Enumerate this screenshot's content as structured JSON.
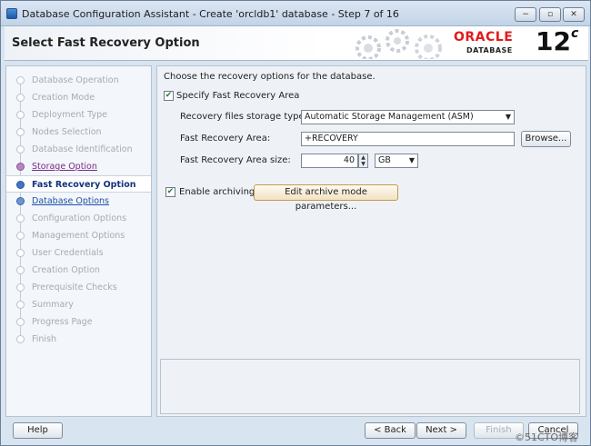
{
  "window": {
    "title": "Database Configuration Assistant - Create 'orcldb1' database - Step 7 of 16",
    "min": "−",
    "max": "▫",
    "close": "✕"
  },
  "banner": {
    "title": "Select Fast Recovery Option",
    "oracle": "ORACLE",
    "database": "DATABASE",
    "version": "12",
    "version_suffix": "c"
  },
  "nav": {
    "items": [
      {
        "label": "Database Operation",
        "state": "disabled"
      },
      {
        "label": "Creation Mode",
        "state": "disabled"
      },
      {
        "label": "Deployment Type",
        "state": "disabled"
      },
      {
        "label": "Nodes Selection",
        "state": "disabled"
      },
      {
        "label": "Database Identification",
        "state": "disabled"
      },
      {
        "label": "Storage Option",
        "state": "visited"
      },
      {
        "label": "Fast Recovery Option",
        "state": "current"
      },
      {
        "label": "Database Options",
        "state": "link"
      },
      {
        "label": "Configuration Options",
        "state": "disabled"
      },
      {
        "label": "Management Options",
        "state": "disabled"
      },
      {
        "label": "User Credentials",
        "state": "disabled"
      },
      {
        "label": "Creation Option",
        "state": "disabled"
      },
      {
        "label": "Prerequisite Checks",
        "state": "disabled"
      },
      {
        "label": "Summary",
        "state": "disabled"
      },
      {
        "label": "Progress Page",
        "state": "disabled"
      },
      {
        "label": "Finish",
        "state": "disabled"
      }
    ]
  },
  "content": {
    "intro": "Choose the recovery options for the database.",
    "specify_fra": {
      "label": "Specify Fast Recovery Area",
      "checked": true,
      "mark": "✔"
    },
    "storage_type": {
      "label": "Recovery files storage type:",
      "value": "Automatic Storage Management (ASM)"
    },
    "fra_location": {
      "label": "Fast Recovery Area:",
      "value": "+RECOVERY",
      "browse": "Browse..."
    },
    "fra_size": {
      "label": "Fast Recovery Area size:",
      "value": "40",
      "unit": "GB"
    },
    "archiving": {
      "label": "Enable archiving",
      "checked": true,
      "mark": "✔",
      "edit_button": "Edit archive mode parameters..."
    }
  },
  "buttons": {
    "help": "Help",
    "back": "< Back",
    "next": "Next >",
    "finish": "Finish",
    "cancel": "Cancel"
  },
  "watermark": "©51CTO博客",
  "colors": {
    "oracle_red": "#e31b1b",
    "link_blue": "#1f4fa8",
    "visited_purple": "#7a2a8a"
  }
}
